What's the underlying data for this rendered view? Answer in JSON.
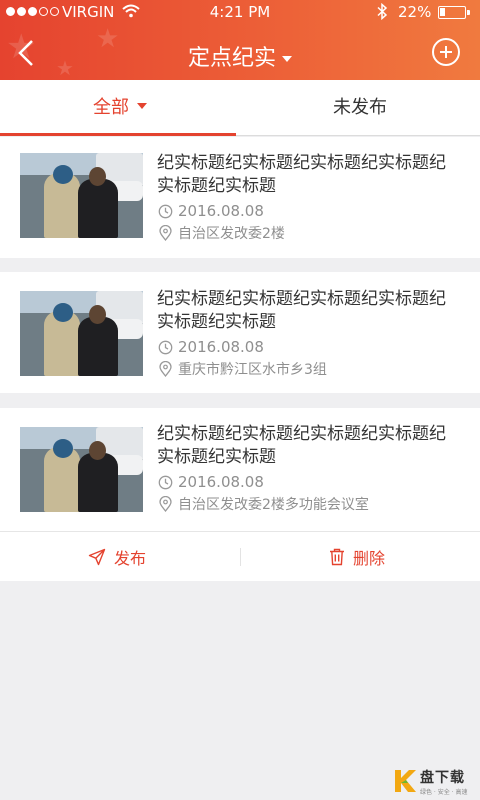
{
  "status_bar": {
    "carrier": "VIRGIN",
    "time": "4:21 PM",
    "battery_percent": "22%",
    "battery_level": 0.22,
    "signal_bars_filled": 3,
    "signal_bars_total": 5
  },
  "header": {
    "title": "定点纪实",
    "accent_color": "#e4432f",
    "back_icon": "chevron-left-icon",
    "add_icon": "plus-circle-icon"
  },
  "tabs": [
    {
      "label": "全部",
      "active": true
    },
    {
      "label": "未发布",
      "active": false
    }
  ],
  "items": [
    {
      "title": "纪实标题纪实标题纪实标题纪实标题纪实标题纪实标题",
      "date": "2016.08.08",
      "location": "自治区发改委2楼"
    },
    {
      "title": "纪实标题纪实标题纪实标题纪实标题纪实标题纪实标题",
      "date": "2016.08.08",
      "location": "重庆市黔江区水市乡3组"
    },
    {
      "title": "纪实标题纪实标题纪实标题纪实标题纪实标题纪实标题",
      "date": "2016.08.08",
      "location": "自治区发改委2楼多功能会议室"
    }
  ],
  "actions": {
    "publish_label": "发布",
    "delete_label": "删除"
  },
  "watermark": {
    "brand": "盘下载",
    "tagline": "绿色 · 安全 · 高速"
  }
}
